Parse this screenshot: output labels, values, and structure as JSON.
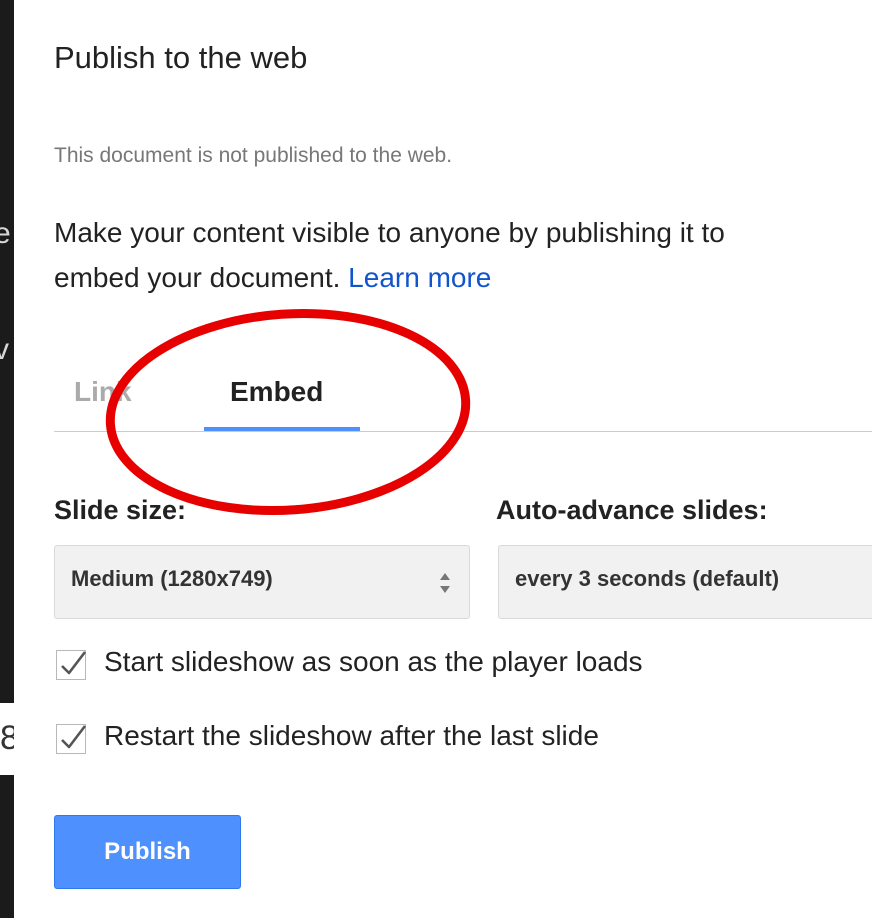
{
  "background": {
    "fragments": [
      "e",
      "l",
      "v"
    ],
    "cut_digit": "8"
  },
  "dialog": {
    "title": "Publish to the web",
    "status": "This document is not published to the web.",
    "description_line1": "Make your content visible to anyone by publishing it to",
    "description_line2_prefix": "embed your document. ",
    "learn_more": "Learn more"
  },
  "tabs": [
    {
      "label": "Link",
      "active": false
    },
    {
      "label": "Embed",
      "active": true
    }
  ],
  "slide_size": {
    "label": "Slide size:",
    "value": "Medium (1280x749)"
  },
  "auto_advance": {
    "label": "Auto-advance slides:",
    "value": "every 3 seconds (default)"
  },
  "options": [
    {
      "label": "Start slideshow as soon as the player loads",
      "checked": true
    },
    {
      "label": "Restart the slideshow after the last slide",
      "checked": true
    }
  ],
  "publish_button": {
    "label": "Publish"
  },
  "colors": {
    "accent": "#4d90fe",
    "link": "#1155cc",
    "annotation": "#e60000"
  }
}
